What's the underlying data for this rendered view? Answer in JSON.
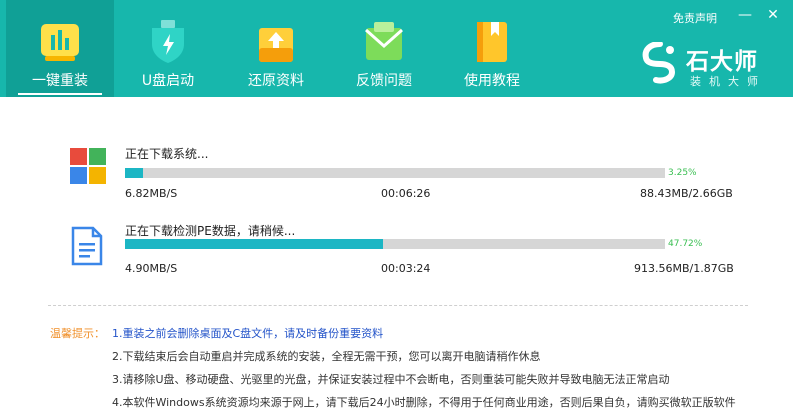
{
  "nav": {
    "items": [
      {
        "label": "一键重装",
        "icon": "bar-chart-icon",
        "active": true
      },
      {
        "label": "U盘启动",
        "icon": "usb-shield-icon"
      },
      {
        "label": "还原资料",
        "icon": "restore-box-icon"
      },
      {
        "label": "反馈问题",
        "icon": "mail-feedback-icon"
      },
      {
        "label": "使用教程",
        "icon": "book-icon"
      }
    ]
  },
  "window": {
    "disclaimer": "免责声明",
    "minimize": "—",
    "close": "✕"
  },
  "brand": {
    "title": "石大师",
    "subtitle": "装机大师",
    "logo_icon": "stone-logo-icon"
  },
  "tasks": [
    {
      "icon": "windows-logo-icon",
      "title": "正在下载系统...",
      "percent_text": "3.25%",
      "progress": 0.0325,
      "speed": "6.82MB/S",
      "time": "00:06:26",
      "size": "88.43MB/2.66GB"
    },
    {
      "icon": "document-icon",
      "title": "正在下载检测PE数据，请稍候...",
      "percent_text": "47.72%",
      "progress": 0.4772,
      "speed": "4.90MB/S",
      "time": "00:03:24",
      "size": "913.56MB/1.87GB"
    }
  ],
  "tips": {
    "label": "温馨提示：",
    "items": [
      "1.重装之前会删除桌面及C盘文件，请及时备份重要资料",
      "2.下载结束后会自动重启并完成系统的安装，全程无需干预，您可以离开电脑请稍作休息",
      "3.请移除U盘、移动硬盘、光驱里的光盘，并保证安装过程中不会断电，否则重装可能失败并导致电脑无法正常启动",
      "4.本软件Windows系统资源均来源于网上，请下载后24小时删除，不得用于任何商业用途，否则后果自负，请购买微软正版软件"
    ]
  },
  "colors": {
    "header": "#17b7ac",
    "active_tab": "#10a096",
    "progress": "#1cb6c4",
    "percent": "#3bbf53",
    "tip_highlight": "#2454c9",
    "tip_label": "#f0912c"
  }
}
